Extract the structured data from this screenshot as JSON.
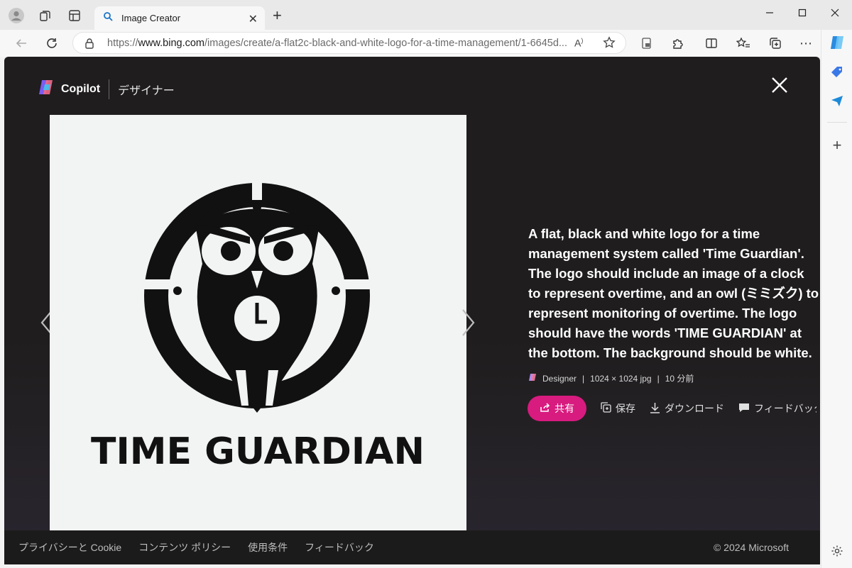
{
  "browser": {
    "tab_title": "Image Creator",
    "url_prefix": "https://",
    "url_domain": "www.bing.com",
    "url_path": "/images/create/a-flat2c-black-and-white-logo-for-a-time-management/1-6645d..."
  },
  "header": {
    "brand": "Copilot",
    "subtitle": "デザイナー"
  },
  "image": {
    "logo_text": "TIME GUARDIAN"
  },
  "details": {
    "prompt": "A flat, black and white logo for a time management system called 'Time Guardian'. The logo should include an image of a clock to represent overtime, and an owl (ミミズク) to represent monitoring of overtime. The logo should have the words 'TIME GUARDIAN' at the bottom. The background should be white.",
    "source": "Designer",
    "separator": "|",
    "size": "1024 × 1024 jpg",
    "time": "10 分前",
    "share_label": "共有",
    "save_label": "保存",
    "download_label": "ダウンロード",
    "feedback_label": "フィードバック"
  },
  "footer": {
    "links": [
      "プライバシーと Cookie",
      "コンテンツ ポリシー",
      "使用条件",
      "フィードバック"
    ],
    "copyright": "© 2024 Microsoft"
  },
  "colors": {
    "accent": "#d81b7f",
    "dialog_bg": "#1f1d1d"
  }
}
